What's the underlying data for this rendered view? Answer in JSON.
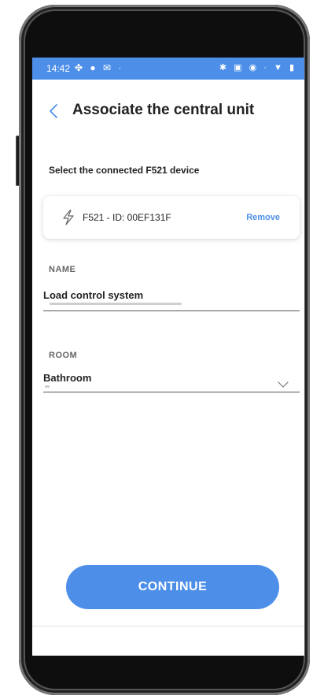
{
  "status_bar": {
    "time": "14:42",
    "left_icons": "✤ ● ✉ ·",
    "right_icons": "✱ ▣ ◉ · ▼ ▮",
    "color": "#4d8fe8"
  },
  "header": {
    "title": "Associate the central unit",
    "back_icon": "chevron-left-icon"
  },
  "device_section": {
    "label": "Select the connected F521 device",
    "device": {
      "icon": "lightning-bolt-icon",
      "name": "F521 - ID: 00EF131F",
      "remove_label": "Remove"
    }
  },
  "name_field": {
    "label": "NAME",
    "value": "Load control system"
  },
  "room_field": {
    "label": "ROOM",
    "value": "Bathroom",
    "icon": "chevron-down-icon"
  },
  "continue_button": {
    "label": "CONTINUE"
  },
  "colors": {
    "accent": "#4d8fe8",
    "text": "#222222",
    "muted": "#666666"
  }
}
